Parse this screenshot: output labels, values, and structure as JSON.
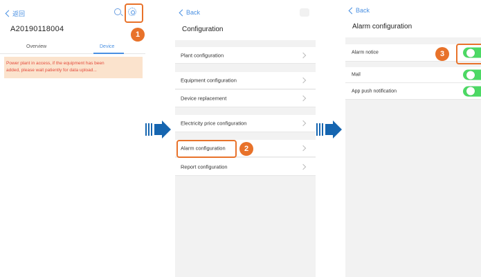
{
  "screen1": {
    "back_label": "返回",
    "device_id": "A20190118004",
    "tabs": {
      "overview": "Overview",
      "device": "Device"
    },
    "banner": [
      "Power plant in access, if the equipment has been",
      "added, please wait patiently for data upload..."
    ],
    "icons": [
      "search-icon",
      "gear-icon"
    ]
  },
  "screen2": {
    "back_label": "Back",
    "title": "Configuration",
    "items": [
      {
        "label": "Plant configuration"
      },
      {
        "label": "Equipment configuration"
      },
      {
        "label": "Device replacement"
      },
      {
        "label": "Electricity price configuration"
      },
      {
        "label": "Alarm configuration"
      },
      {
        "label": "Report configuration"
      }
    ]
  },
  "screen3": {
    "back_label": "Back",
    "title": "Alarm configuration",
    "items": [
      {
        "label": "Alarm notice",
        "enabled": true
      },
      {
        "label": "Mail",
        "enabled": true
      },
      {
        "label": "App push notification",
        "enabled": true
      }
    ]
  },
  "annotations": {
    "step1": "1",
    "step2": "2",
    "step3": "3"
  },
  "colors": {
    "accent": "#4a90e2",
    "highlight": "#e8722a",
    "toggle_on": "#4cd964",
    "warning_text": "#e34b3c",
    "warning_bg": "#fbe3cd",
    "flow_arrow": "#1565b0"
  }
}
